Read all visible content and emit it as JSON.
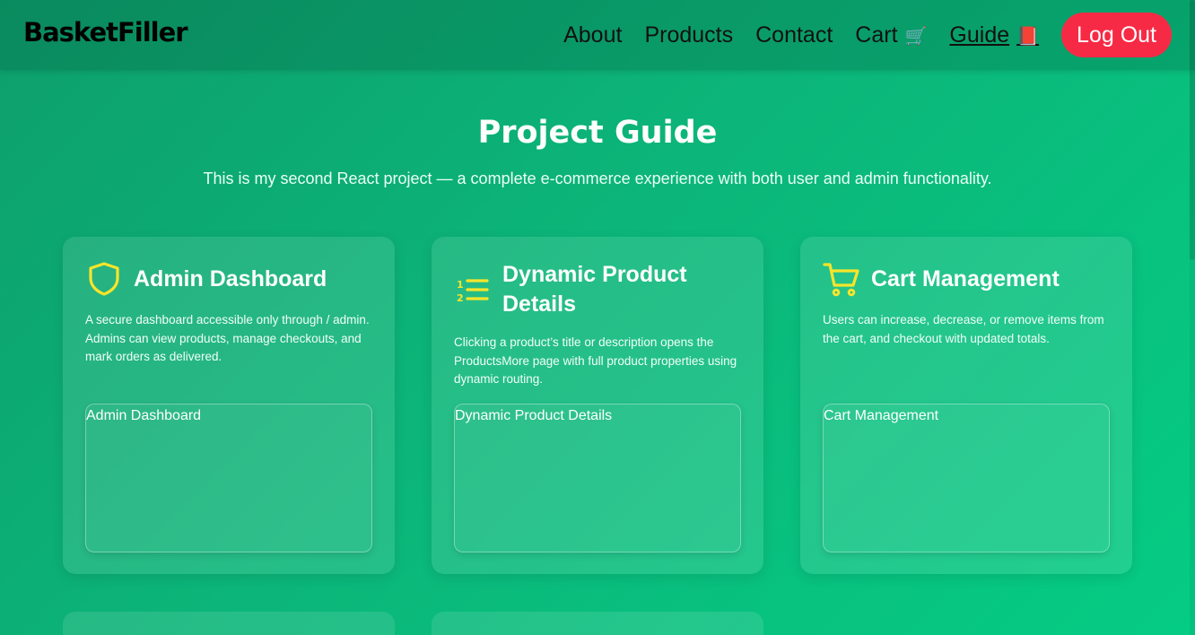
{
  "brand": "BasketFiller",
  "nav": {
    "about": "About",
    "products": "Products",
    "contact": "Contact",
    "cart": "Cart",
    "cart_emoji": "🛒",
    "guide": "Guide",
    "guide_emoji": "📕",
    "logout": "Log Out"
  },
  "page": {
    "title": "Project Guide",
    "subtitle": "This is my second React project — a complete e-commerce experience with both user and admin functionality."
  },
  "cards": [
    {
      "title": "Admin Dashboard",
      "description": "A secure dashboard accessible only through / admin. Admins can view products, manage checkouts, and mark orders as delivered.",
      "image_alt": "Admin Dashboard",
      "icon": "shield-icon"
    },
    {
      "title": "Dynamic Product Details",
      "description": "Clicking a product’s title or description opens the ProductsMore page with full product properties using dynamic routing.",
      "image_alt": "Dynamic Product Details",
      "icon": "numbered-list-icon"
    },
    {
      "title": "Cart Management",
      "description": "Users can increase, decrease, or remove items from the cart, and checkout with updated totals.",
      "image_alt": "Cart Management",
      "icon": "cart-icon"
    }
  ],
  "colors": {
    "accent_icon": "#f7e52b",
    "logout_bg": "#f72a45",
    "bg_start": "#0d9f6c",
    "bg_end": "#05cc84"
  }
}
